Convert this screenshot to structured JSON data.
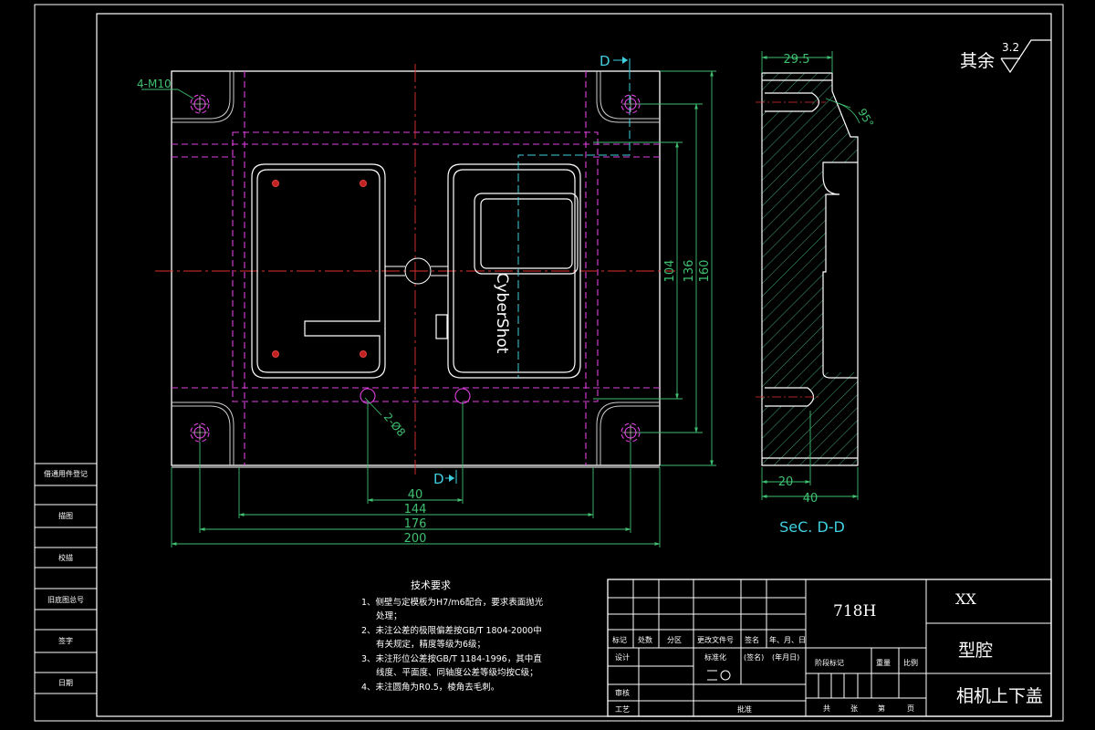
{
  "view": {
    "marker_top": "D",
    "marker_bottom": "D",
    "hole_callout": "4-M10",
    "pin_callout": "2-Ø8",
    "product_label": "CyberShot",
    "dims_bottom": [
      "40",
      "144",
      "176",
      "200"
    ],
    "dims_right": [
      "104",
      "136",
      "160"
    ]
  },
  "section": {
    "title": "SeC. D-D",
    "dim_top": "29.5",
    "dim_angle": "95°",
    "dim_bottom_small": "20",
    "dim_bottom": "40"
  },
  "roughness": {
    "label": "其余",
    "value": "3.2"
  },
  "side_labels": [
    "借通用件登记",
    "描图",
    "校描",
    "旧底图总号",
    "签字",
    "日期"
  ],
  "tech": {
    "heading": "技术要求",
    "items": [
      "1、侧壁与定模板为H7/m6配合，要求表面抛光",
      "处理；",
      "2、未注公差的极限偏差按GB/T 1804-2000中",
      "有关规定，精度等级为6级；",
      "3、未注形位公差按GB/T 1184-1996，其中直",
      "线度、平面度、同轴度公差等级均按C级；",
      "4、未注圆角为R0.5，棱角去毛刺。"
    ]
  },
  "title_block": {
    "material": "718H",
    "company": "XX",
    "part_name": "型腔",
    "drawing_name": "相机上下盖",
    "rev_headers": [
      "标记",
      "处数",
      "分区",
      "更改文件号",
      "签名",
      "年、月、日"
    ],
    "role_design": "设计",
    "role_review": "审核",
    "role_process": "工艺",
    "standardize": "标准化",
    "sign": "(签名)",
    "date": "(年月日)",
    "approve": "批准",
    "stage_headers": [
      "阶段标记",
      "重量",
      "比例"
    ],
    "sheet_info": [
      "共",
      "张",
      "第",
      "页"
    ]
  }
}
